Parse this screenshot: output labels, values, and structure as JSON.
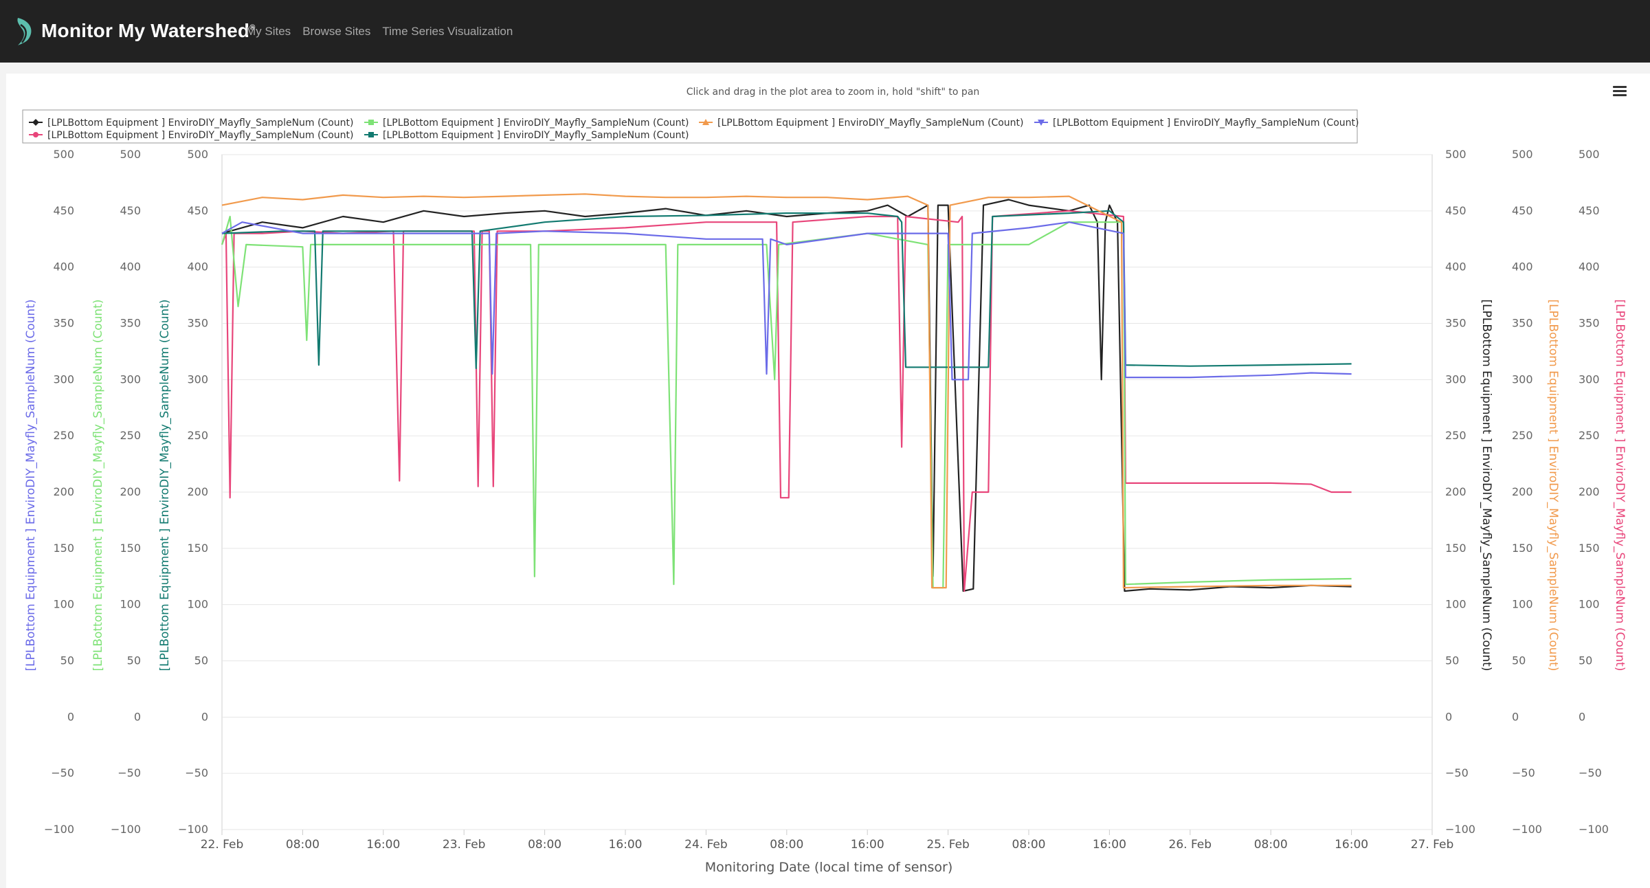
{
  "header": {
    "brand": "Monitor My Watershed",
    "brand_mark": "®",
    "nav": [
      "My Sites",
      "Browse Sites",
      "Time Series Visualization"
    ]
  },
  "chart": {
    "hint": "Click and drag in the plot area to zoom in, hold \"shift\" to pan",
    "menu_icon": "hamburger-menu-icon",
    "xlabel": "Monitoring Date (local time of sensor)"
  },
  "chart_data": {
    "type": "line",
    "xlim": [
      "2021-02-22 00:00",
      "2021-02-27 00:00"
    ],
    "ylim": [
      -100,
      500
    ],
    "grid": true,
    "legend_position": "top-left",
    "x_ticks": [
      "22. Feb",
      "08:00",
      "16:00",
      "23. Feb",
      "08:00",
      "16:00",
      "24. Feb",
      "08:00",
      "16:00",
      "25. Feb",
      "08:00",
      "16:00",
      "26. Feb",
      "08:00",
      "16:00",
      "27. Feb"
    ],
    "y_ticks": [
      500,
      450,
      400,
      350,
      300,
      250,
      200,
      150,
      100,
      50,
      0,
      -50,
      -100
    ],
    "left_axes": [
      {
        "label": "[LPLBottom Equipment ] EnviroDIY_Mayfly_SampleNum (Count)",
        "color": "#6b6be8"
      },
      {
        "label": "[LPLBottom Equipment ] EnviroDIY_Mayfly_SampleNum (Count)",
        "color": "#7ee276"
      },
      {
        "label": "[LPLBottom Equipment ] EnviroDIY_Mayfly_SampleNum (Count)",
        "color": "#127a70"
      }
    ],
    "right_axes": [
      {
        "label": "[LPLBottom Equipment ] EnviroDIY_Mayfly_SampleNum (Count)",
        "color": "#222222"
      },
      {
        "label": "[LPLBottom Equipment ] EnviroDIY_Mayfly_SampleNum (Count)",
        "color": "#f19a4c"
      },
      {
        "label": "[LPLBottom Equipment ] EnviroDIY_Mayfly_SampleNum (Count)",
        "color": "#e8457a"
      }
    ],
    "series": [
      {
        "name": "[LPLBottom Equipment ] EnviroDIY_Mayfly_SampleNum (Count)",
        "color": "#222222",
        "marker": "diamond",
        "points": [
          [
            0,
            430
          ],
          [
            4,
            440
          ],
          [
            8,
            435
          ],
          [
            12,
            445
          ],
          [
            16,
            440
          ],
          [
            20,
            450
          ],
          [
            24,
            445
          ],
          [
            28,
            448
          ],
          [
            32,
            450
          ],
          [
            36,
            445
          ],
          [
            40,
            448
          ],
          [
            44,
            452
          ],
          [
            48,
            446
          ],
          [
            52,
            450
          ],
          [
            56,
            445
          ],
          [
            60,
            448
          ],
          [
            64,
            450
          ],
          [
            66,
            455
          ],
          [
            68,
            445
          ],
          [
            70,
            455
          ],
          [
            70.5,
            125
          ],
          [
            71,
            455
          ],
          [
            72,
            455
          ],
          [
            73.5,
            112
          ],
          [
            74.5,
            114
          ],
          [
            75.5,
            455
          ],
          [
            78,
            460
          ],
          [
            80,
            455
          ],
          [
            84,
            450
          ],
          [
            86,
            455
          ],
          [
            86.8,
            440
          ],
          [
            87.2,
            300
          ],
          [
            87.6,
            440
          ],
          [
            88,
            455
          ],
          [
            88.8,
            440
          ],
          [
            89.5,
            112
          ],
          [
            92,
            114
          ],
          [
            96,
            113
          ],
          [
            100,
            116
          ],
          [
            104,
            115
          ],
          [
            108,
            117
          ],
          [
            112,
            116
          ]
        ]
      },
      {
        "name": "[LPLBottom Equipment ] EnviroDIY_Mayfly_SampleNum (Count)",
        "color": "#e8457a",
        "marker": "circle",
        "points": [
          [
            0,
            420
          ],
          [
            0.4,
            430
          ],
          [
            0.8,
            195
          ],
          [
            1.2,
            430
          ],
          [
            4,
            430
          ],
          [
            8,
            432
          ],
          [
            12,
            430
          ],
          [
            17,
            432
          ],
          [
            17.6,
            210
          ],
          [
            18,
            432
          ],
          [
            25,
            432
          ],
          [
            25.4,
            205
          ],
          [
            25.8,
            432
          ],
          [
            26.5,
            432
          ],
          [
            26.9,
            205
          ],
          [
            27.3,
            432
          ],
          [
            32,
            432
          ],
          [
            40,
            435
          ],
          [
            48,
            440
          ],
          [
            55,
            440
          ],
          [
            55.4,
            195
          ],
          [
            56.2,
            195
          ],
          [
            56.6,
            440
          ],
          [
            64,
            445
          ],
          [
            67,
            445
          ],
          [
            67.4,
            240
          ],
          [
            67.8,
            445
          ],
          [
            73,
            440
          ],
          [
            73.4,
            445
          ],
          [
            73.6,
            112
          ],
          [
            74.4,
            200
          ],
          [
            76,
            200
          ],
          [
            76.4,
            445
          ],
          [
            84,
            450
          ],
          [
            89.4,
            445
          ],
          [
            89.6,
            208
          ],
          [
            96,
            208
          ],
          [
            104,
            208
          ],
          [
            108,
            207
          ],
          [
            110,
            200
          ],
          [
            112,
            200
          ]
        ]
      },
      {
        "name": "[LPLBottom Equipment ] EnviroDIY_Mayfly_SampleNum (Count)",
        "color": "#7ee276",
        "marker": "square",
        "points": [
          [
            0,
            420
          ],
          [
            0.8,
            445
          ],
          [
            1.6,
            365
          ],
          [
            2.4,
            420
          ],
          [
            8,
            418
          ],
          [
            8.4,
            335
          ],
          [
            8.8,
            420
          ],
          [
            16,
            420
          ],
          [
            24,
            420
          ],
          [
            30.6,
            420
          ],
          [
            31,
            125
          ],
          [
            31.4,
            420
          ],
          [
            44,
            420
          ],
          [
            44.8,
            118
          ],
          [
            45.2,
            420
          ],
          [
            54,
            420
          ],
          [
            54.8,
            300
          ],
          [
            55.2,
            420
          ],
          [
            64,
            430
          ],
          [
            70,
            420
          ],
          [
            70.5,
            115
          ],
          [
            71.5,
            115
          ],
          [
            72,
            420
          ],
          [
            80,
            420
          ],
          [
            84,
            440
          ],
          [
            89.4,
            440
          ],
          [
            89.6,
            118
          ],
          [
            96,
            120
          ],
          [
            104,
            122
          ],
          [
            112,
            123
          ]
        ]
      },
      {
        "name": "[LPLBottom Equipment ] EnviroDIY_Mayfly_SampleNum (Count)",
        "color": "#127a70",
        "marker": "square",
        "points": [
          [
            0,
            430
          ],
          [
            6,
            432
          ],
          [
            9.2,
            432
          ],
          [
            9.6,
            313
          ],
          [
            10,
            432
          ],
          [
            20,
            432
          ],
          [
            24.8,
            432
          ],
          [
            25.2,
            310
          ],
          [
            25.6,
            432
          ],
          [
            32,
            440
          ],
          [
            40,
            445
          ],
          [
            48,
            446
          ],
          [
            56,
            448
          ],
          [
            64,
            448
          ],
          [
            67,
            445
          ],
          [
            67.4,
            440
          ],
          [
            67.8,
            311
          ],
          [
            72,
            311
          ],
          [
            76,
            311
          ],
          [
            76.4,
            445
          ],
          [
            84,
            448
          ],
          [
            88,
            450
          ],
          [
            89.4,
            440
          ],
          [
            89.6,
            313
          ],
          [
            96,
            312
          ],
          [
            104,
            313
          ],
          [
            112,
            314
          ]
        ]
      },
      {
        "name": "[LPLBottom Equipment ] EnviroDIY_Mayfly_SampleNum (Count)",
        "color": "#f19a4c",
        "marker": "triangle",
        "points": [
          [
            0,
            455
          ],
          [
            4,
            462
          ],
          [
            8,
            460
          ],
          [
            12,
            464
          ],
          [
            16,
            462
          ],
          [
            20,
            463
          ],
          [
            24,
            462
          ],
          [
            28,
            463
          ],
          [
            32,
            464
          ],
          [
            36,
            465
          ],
          [
            40,
            463
          ],
          [
            44,
            462
          ],
          [
            48,
            462
          ],
          [
            52,
            463
          ],
          [
            56,
            462
          ],
          [
            60,
            462
          ],
          [
            64,
            460
          ],
          [
            68,
            463
          ],
          [
            70,
            455
          ],
          [
            70.4,
            115
          ],
          [
            71.8,
            115
          ],
          [
            72.2,
            455
          ],
          [
            76,
            462
          ],
          [
            80,
            462
          ],
          [
            84,
            463
          ],
          [
            89.2,
            440
          ],
          [
            89.4,
            115
          ],
          [
            96,
            116
          ],
          [
            104,
            117
          ],
          [
            112,
            117
          ]
        ]
      },
      {
        "name": "[LPLBottom Equipment ] EnviroDIY_Mayfly_SampleNum (Count)",
        "color": "#6b6be8",
        "marker": "triangle-down",
        "points": [
          [
            0,
            430
          ],
          [
            2,
            440
          ],
          [
            8,
            430
          ],
          [
            16,
            430
          ],
          [
            24,
            430
          ],
          [
            26.5,
            430
          ],
          [
            26.8,
            305
          ],
          [
            27.2,
            430
          ],
          [
            32,
            432
          ],
          [
            40,
            430
          ],
          [
            48,
            425
          ],
          [
            53.6,
            425
          ],
          [
            54,
            305
          ],
          [
            54.4,
            425
          ],
          [
            56,
            420
          ],
          [
            64,
            430
          ],
          [
            70,
            430
          ],
          [
            72,
            430
          ],
          [
            72.4,
            300
          ],
          [
            74,
            300
          ],
          [
            74.4,
            430
          ],
          [
            80,
            435
          ],
          [
            84,
            440
          ],
          [
            89.4,
            430
          ],
          [
            89.6,
            302
          ],
          [
            96,
            302
          ],
          [
            104,
            304
          ],
          [
            108,
            306
          ],
          [
            112,
            305
          ]
        ]
      }
    ]
  }
}
